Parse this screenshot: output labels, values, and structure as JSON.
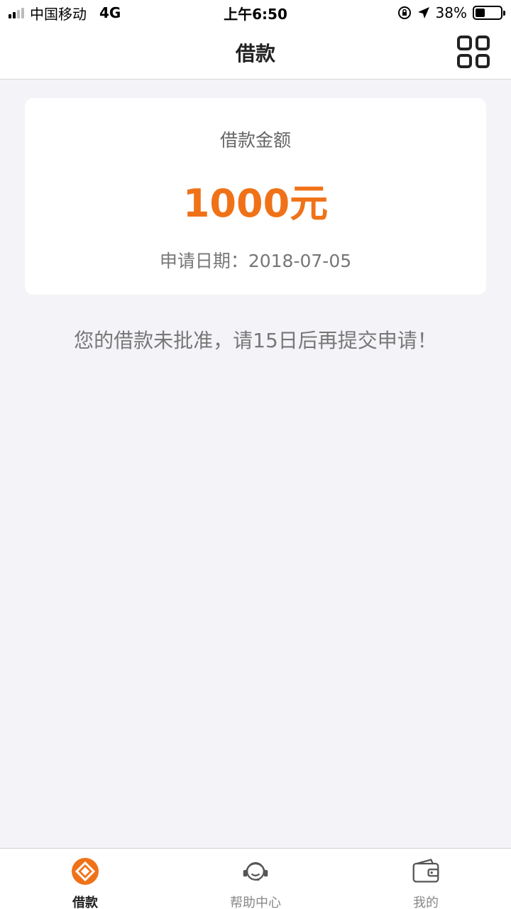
{
  "status_bar": {
    "carrier": "中国移动",
    "network": "4G",
    "time": "上午6:50",
    "battery_text": "38%",
    "battery_level": 0.38
  },
  "nav": {
    "title": "借款",
    "menu_icon": "grid-icon"
  },
  "loan": {
    "label": "借款金额",
    "amount": "1000元",
    "date_text": "申请日期：2018-07-05"
  },
  "notice": "您的借款未批准，请15日后再提交申请！",
  "tabs": [
    {
      "label": "借款",
      "icon": "loan-icon",
      "active": true
    },
    {
      "label": "帮助中心",
      "icon": "headset-icon",
      "active": false
    },
    {
      "label": "我的",
      "icon": "wallet-icon",
      "active": false
    }
  ],
  "colors": {
    "accent": "#f07218",
    "background": "#f4f4f8"
  }
}
